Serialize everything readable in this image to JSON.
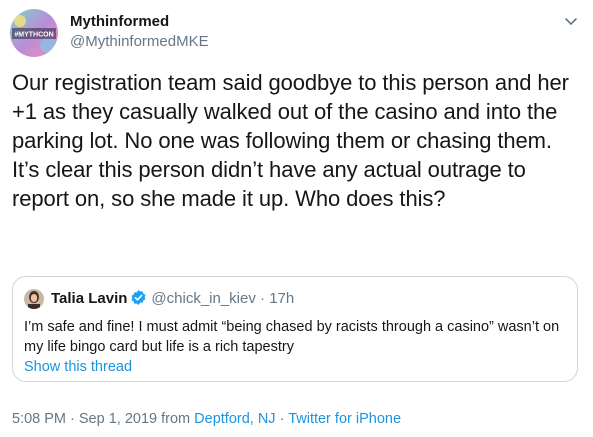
{
  "tweet": {
    "author": {
      "name": "Mythinformed",
      "handle": "@MythinformedMKE",
      "avatar_text": "#MYTHCON"
    },
    "text": "Our registration team said goodbye to this person and her +1 as they casually walked out of the casino and into the parking lot. No one was following them or chasing them. It’s clear this person didn’t have any actual outrage to report on, so she made it up. Who does this?",
    "quoted": {
      "name": "Talia Lavin",
      "handle": "@chick_in_kiev",
      "separator": " · ",
      "time": "17h",
      "text": "I’m safe and fine! I must admit “being chased by racists through a casino” wasn’t on my life bingo card but life is a rich tapestry",
      "show_thread": "Show this thread"
    },
    "meta": {
      "timestamp": "5:08 PM · Sep 1, 2019 from ",
      "location": "Deptford, NJ",
      "separator": " · ",
      "client": "Twitter for iPhone"
    }
  },
  "colors": {
    "text": "#14171a",
    "secondary": "#657786",
    "link": "#1b95e0",
    "border": "#ccd6dd",
    "verified": "#1da1f2"
  },
  "icons": {
    "caret": "chevron-down-icon",
    "verified": "verified-badge-icon"
  }
}
